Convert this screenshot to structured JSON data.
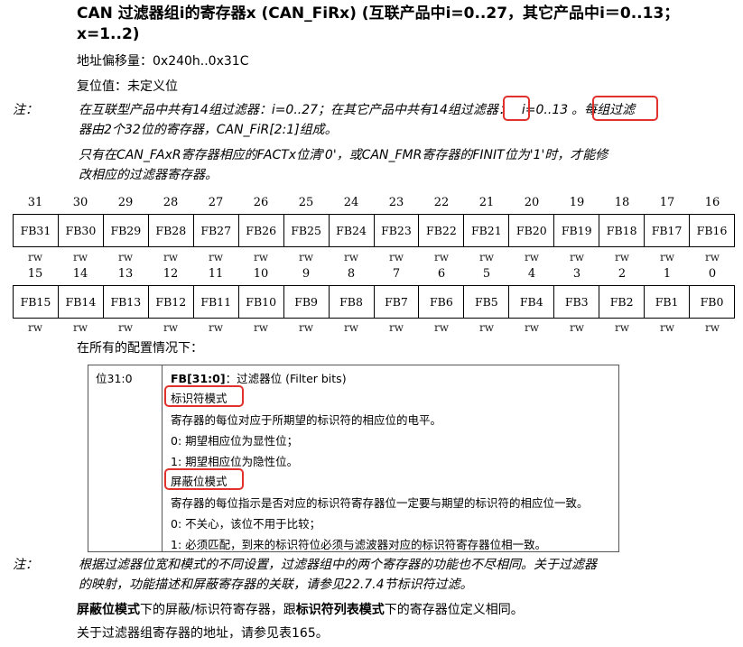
{
  "title": {
    "bold_a": "CAN 过滤器组",
    "bold_i": "i",
    "bold_b": "的寄存器x (CAN_FiRx) (互联产品中",
    "bold_c": "i=0..27，其它产品中",
    "bold_d": "i＝0..13；",
    "line2": "x=1..2)"
  },
  "meta": {
    "offset": "地址偏移量：0x240h..0x31C",
    "reset": "复位值：未定义位"
  },
  "note1": {
    "label": "注：",
    "seg1": "在互联型产品中共有14组过滤器：i=0..27；在其它产品中共有",
    "seg2": "14",
    "seg3": "组过滤器：",
    "seg4": "i=0..13",
    "seg5": "。每组过滤",
    "line2": "器由2个32位的寄存器，CAN_FiR[2:1]组成。",
    "line3": "只有在CAN_FAxR寄存器相应的FACTx位清'0'，或CAN_FMR寄存器的FINIT位为'1'时，才能修",
    "line4": "改相应的过滤器寄存器。"
  },
  "upper": {
    "bits": [
      "31",
      "30",
      "29",
      "28",
      "27",
      "26",
      "25",
      "24",
      "23",
      "22",
      "21",
      "20",
      "19",
      "18",
      "17",
      "16"
    ],
    "fields": [
      "FB31",
      "FB30",
      "FB29",
      "FB28",
      "FB27",
      "FB26",
      "FB25",
      "FB24",
      "FB23",
      "FB22",
      "FB21",
      "FB20",
      "FB19",
      "FB18",
      "FB17",
      "FB16"
    ],
    "access": [
      "rw",
      "rw",
      "rw",
      "rw",
      "rw",
      "rw",
      "rw",
      "rw",
      "rw",
      "rw",
      "rw",
      "rw",
      "rw",
      "rw",
      "rw",
      "rw"
    ]
  },
  "lower": {
    "bits": [
      "15",
      "14",
      "13",
      "12",
      "11",
      "10",
      "9",
      "8",
      "7",
      "6",
      "5",
      "4",
      "3",
      "2",
      "1",
      "0"
    ],
    "fields": [
      "FB15",
      "FB14",
      "FB13",
      "FB12",
      "FB11",
      "FB10",
      "FB9",
      "FB8",
      "FB7",
      "FB6",
      "FB5",
      "FB4",
      "FB3",
      "FB2",
      "FB1",
      "FB0"
    ],
    "access": [
      "rw",
      "rw",
      "rw",
      "rw",
      "rw",
      "rw",
      "rw",
      "rw",
      "rw",
      "rw",
      "rw",
      "rw",
      "rw",
      "rw",
      "rw",
      "rw"
    ]
  },
  "config_heading": "在所有的配置情况下：",
  "desc": {
    "bits": "位31:0",
    "field_name": "FB[31:0]",
    "field_desc": "：过滤器位 (Filter bits)",
    "id_mode": "标识符模式",
    "id_line1": "寄存器的每位对应于所期望的标识符的相应位的电平。",
    "id_line2": "0: 期望相应位为显性位；",
    "id_line3": "1: 期望相应位为隐性位。",
    "mask_mode": "屏蔽位模式",
    "mask_line1": "寄存器的每位指示是否对应的标识符寄存器位一定要与期望的标识符的相应位一致。",
    "mask_line2": "0: 不关心，该位不用于比较；",
    "mask_line3": "1: 必须匹配，到来的标识符位必须与滤波器对应的标识符寄存器位相一致。"
  },
  "note2": {
    "label": "注：",
    "line1": "根据过滤器位宽和模式的不同设置，过滤器组中的两个寄存器的功能也不尽相同。关于过滤器",
    "line2": "的映射，功能描述和屏蔽寄存器的关联，请参见22.7.4节标识符过滤。"
  },
  "footer": {
    "mask_bold": "屏蔽位模式",
    "mid": "下的屏蔽/标识符寄存器，跟",
    "list_bold": "标识符列表模式",
    "end": "下的寄存器位定义相同。",
    "line2": "关于过滤器组寄存器的地址，请参见表165。"
  }
}
